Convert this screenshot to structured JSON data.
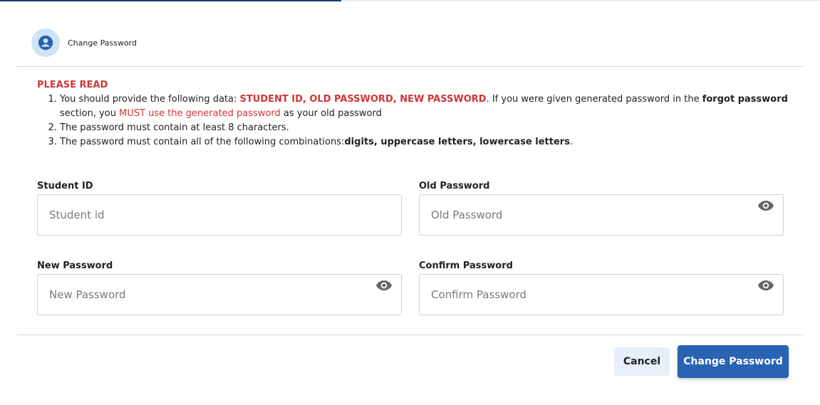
{
  "header": {
    "title": "Change Password",
    "avatar_icon": "user-circle-icon",
    "progress_percent": 41.6
  },
  "notice": {
    "heading": "PLEASE READ",
    "item1": {
      "prefix": "You should provide the following data: ",
      "fields": "STUDENT ID, OLD PASSWORD, NEW PASSWORD",
      "middle": ". If you were given generated password in the ",
      "section": "forgot password",
      "after_section": " section, you ",
      "must": "MUST use the generated password",
      "suffix": " as your old password"
    },
    "item2": "The password must contain at least 8 characters.",
    "item3": {
      "prefix": "The password must contain all of the following combinations:",
      "combos": "digits, uppercase letters, lowercase letters",
      "suffix": "."
    }
  },
  "form": {
    "student_id": {
      "label": "Student ID",
      "placeholder": "Student id",
      "value": ""
    },
    "old_password": {
      "label": "Old Password",
      "placeholder": "Old Password",
      "value": "",
      "icon": "eye-icon"
    },
    "new_password": {
      "label": "New Password",
      "placeholder": "New Password",
      "value": "",
      "icon": "eye-icon"
    },
    "confirm_password": {
      "label": "Confirm Password",
      "placeholder": "Confirm Password",
      "value": "",
      "icon": "eye-icon"
    }
  },
  "actions": {
    "cancel_label": "Cancel",
    "submit_label": "Change Password"
  },
  "colors": {
    "accent": "#2863b4",
    "warning": "#d13438",
    "cancel_bg": "#e6effa",
    "avatar_bg": "#cfe3f7"
  }
}
